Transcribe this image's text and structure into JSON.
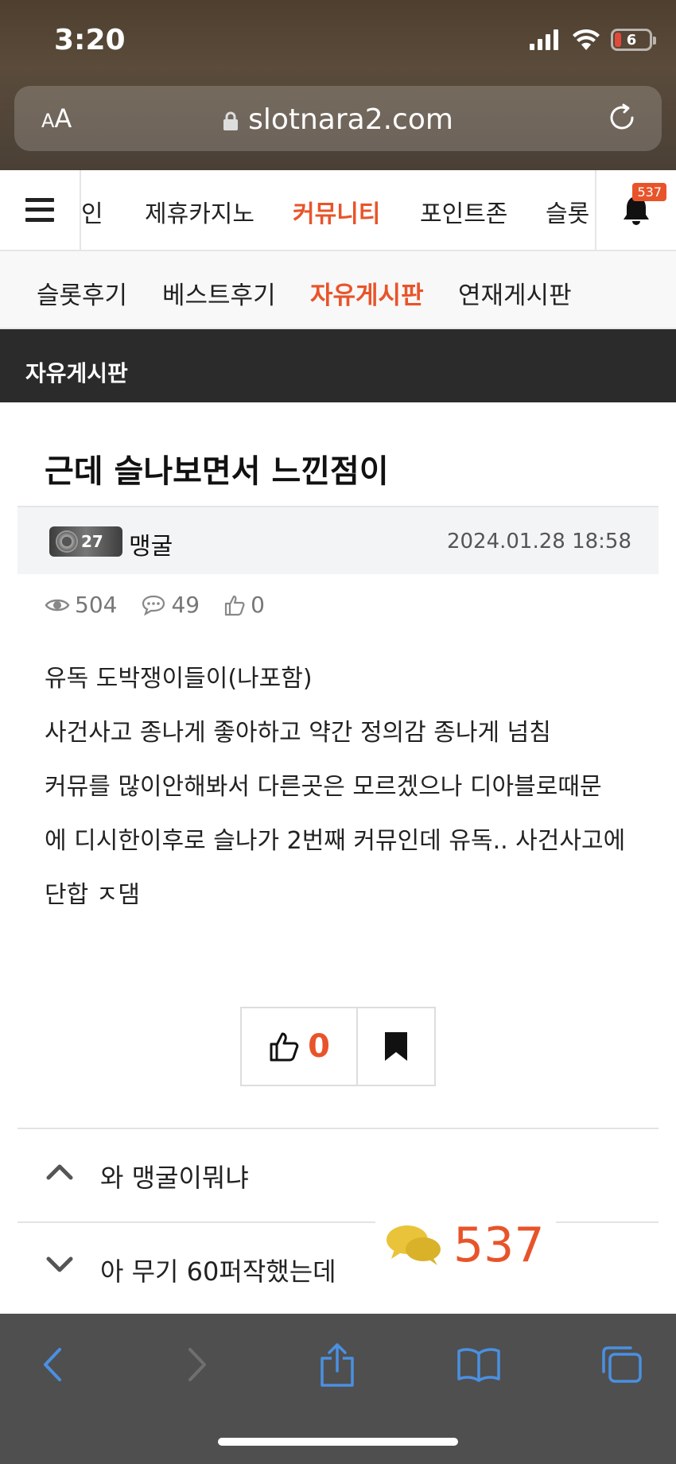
{
  "status_bar": {
    "time": "3:20",
    "battery": "6"
  },
  "browser": {
    "aa_label_small": "A",
    "aa_label_big": "A",
    "url": "slotnara2.com"
  },
  "main_nav": {
    "items": [
      {
        "label": "인",
        "active": false
      },
      {
        "label": "제휴카지노",
        "active": false
      },
      {
        "label": "커뮤니티",
        "active": true
      },
      {
        "label": "포인트존",
        "active": false
      },
      {
        "label": "슬롯",
        "active": false
      }
    ],
    "notification_count": "537"
  },
  "sub_nav": {
    "items": [
      {
        "label": "슬롯후기",
        "active": false
      },
      {
        "label": "베스트후기",
        "active": false
      },
      {
        "label": "자유게시판",
        "active": true
      },
      {
        "label": "연재게시판",
        "active": false
      }
    ]
  },
  "board": {
    "title": "자유게시판"
  },
  "post": {
    "title": "근데 슬나보면서 느낀점이",
    "level": "27",
    "author": "맹굴",
    "date": "2024.01.28 18:58",
    "views": "504",
    "comments": "49",
    "likes": "0",
    "body_lines": [
      "유독 도박쟁이들이(나포함)",
      "사건사고 종나게 좋아하고 약간 정의감 종나게 넘침",
      "커뮤를 많이안해봐서 다른곳은 모르겠으나 디아블로때문",
      "에 디시한이후로 슬나가 2번째 커뮤인데 유독.. 사건사고에",
      "단합 ㅈ댐"
    ]
  },
  "actions": {
    "like_count": "0"
  },
  "adjacent_posts": {
    "prev_title": "와 맹굴이뭐냐",
    "next_title": "아 무기 60퍼작했는데"
  },
  "chat_float": {
    "count": "537"
  },
  "colors": {
    "accent": "#e8542a",
    "board_header_bg": "#2b2b2b",
    "toolbar_bg": "#4f4f4f",
    "link_blue": "#4a90e2"
  }
}
